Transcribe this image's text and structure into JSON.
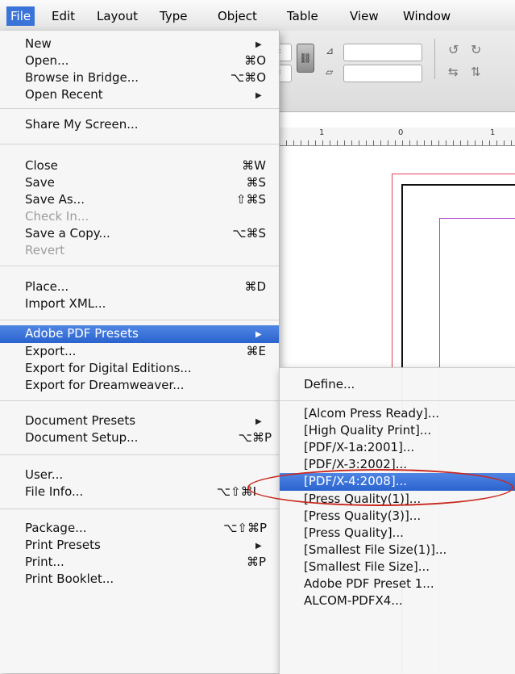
{
  "menubar": {
    "items": [
      "File",
      "Edit",
      "Layout",
      "Type",
      "Object",
      "Table",
      "View",
      "Window"
    ]
  },
  "file_menu": {
    "items": [
      {
        "label": "New",
        "shortcut": "",
        "submenu": true
      },
      {
        "label": "Open...",
        "shortcut": "⌘O"
      },
      {
        "label": "Browse in Bridge...",
        "shortcut": "⌥⌘O"
      },
      {
        "label": "Open Recent",
        "shortcut": "",
        "submenu": true
      },
      {
        "label": "Share My Screen...",
        "shortcut": ""
      },
      {
        "label": "Close",
        "shortcut": "⌘W"
      },
      {
        "label": "Save",
        "shortcut": "⌘S"
      },
      {
        "label": "Save As...",
        "shortcut": "⇧⌘S"
      },
      {
        "label": "Check In...",
        "shortcut": "",
        "disabled": true
      },
      {
        "label": "Save a Copy...",
        "shortcut": "⌥⌘S"
      },
      {
        "label": "Revert",
        "shortcut": "",
        "disabled": true
      },
      {
        "label": "Place...",
        "shortcut": "⌘D"
      },
      {
        "label": "Import XML...",
        "shortcut": ""
      },
      {
        "label": "Adobe PDF Presets",
        "shortcut": "",
        "submenu": true,
        "highlighted": true
      },
      {
        "label": "Export...",
        "shortcut": "⌘E"
      },
      {
        "label": "Export for Digital Editions...",
        "shortcut": ""
      },
      {
        "label": "Export for Dreamweaver...",
        "shortcut": ""
      },
      {
        "label": "Document Presets",
        "shortcut": "",
        "submenu": true
      },
      {
        "label": "Document Setup...",
        "shortcut": "⌥⌘P"
      },
      {
        "label": "User...",
        "shortcut": ""
      },
      {
        "label": "File Info...",
        "shortcut": "⌥⇧⌘I"
      },
      {
        "label": "Package...",
        "shortcut": "⌥⇧⌘P"
      },
      {
        "label": "Print Presets",
        "shortcut": "",
        "submenu": true
      },
      {
        "label": "Print...",
        "shortcut": "⌘P"
      },
      {
        "label": "Print Booklet...",
        "shortcut": ""
      }
    ]
  },
  "pdf_presets_menu": {
    "items": [
      {
        "label": "Define..."
      },
      {
        "label": "[Alcom Press Ready]..."
      },
      {
        "label": "[High Quality Print]..."
      },
      {
        "label": "[PDF/X-1a:2001]..."
      },
      {
        "label": "[PDF/X-3:2002]..."
      },
      {
        "label": "[PDF/X-4:2008]...",
        "highlighted": true
      },
      {
        "label": "[Press Quality(1)]..."
      },
      {
        "label": "[Press Quality(3)]..."
      },
      {
        "label": "[Press Quality]..."
      },
      {
        "label": "[Smallest File Size(1)]..."
      },
      {
        "label": "[Smallest File Size]..."
      },
      {
        "label": "Adobe PDF Preset 1..."
      },
      {
        "label": "ALCOM-PDFX4..."
      }
    ]
  },
  "ruler": {
    "labels": [
      "1",
      "0",
      "1"
    ]
  },
  "colors": {
    "highlight": "#3b74d8",
    "annotation_circle": "#c8281e",
    "bleed_guide": "#e0405a",
    "margin_guide": "#b040d0"
  }
}
